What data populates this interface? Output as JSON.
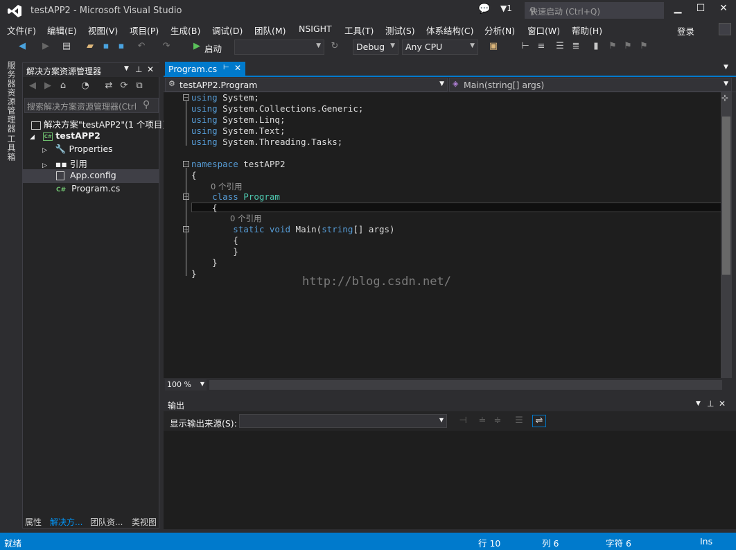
{
  "window": {
    "title": "testAPP2 - Microsoft Visual Studio",
    "notify_count": "1",
    "quick_launch_placeholder": "快速启动 (Ctrl+Q)",
    "login": "登录"
  },
  "menu": [
    "文件(F)",
    "编辑(E)",
    "视图(V)",
    "项目(P)",
    "生成(B)",
    "调试(D)",
    "团队(M)",
    "NSIGHT",
    "工具(T)",
    "测试(S)",
    "体系结构(C)",
    "分析(N)",
    "窗口(W)",
    "帮助(H)"
  ],
  "toolbar": {
    "start_label": "启动",
    "config": "Debug",
    "platform": "Any CPU"
  },
  "left_tabs": [
    "服务器资源管理器",
    "工具箱"
  ],
  "solution_explorer": {
    "title": "解决方案资源管理器",
    "search_placeholder": "搜索解决方案资源管理器(Ctrl",
    "solution": "解决方案\"testAPP2\"(1 个项目)",
    "project": "testAPP2",
    "items": [
      "Properties",
      "引用",
      "App.config",
      "Program.cs"
    ],
    "bottom_tabs": [
      "属性",
      "解决方...",
      "团队资...",
      "类视图"
    ]
  },
  "editor": {
    "tab": "Program.cs",
    "nav_class": "testAPP2.Program",
    "nav_member": "Main(string[] args)",
    "zoom": "100 %",
    "watermark": "http://blog.csdn.net/",
    "ref_hint": "0 个引用",
    "code": {
      "using_kw": "using",
      "usings": [
        "System;",
        "System.Collections.Generic;",
        "System.Linq;",
        "System.Text;",
        "System.Threading.Tasks;"
      ],
      "namespace_kw": "namespace",
      "namespace_name": "testAPP2",
      "class_kw": "class",
      "class_name": "Program",
      "static_kw": "static",
      "void_kw": "void",
      "method_name": "Main(",
      "string_kw": "string",
      "params_rest": "[] args)",
      "open_brace": "{",
      "close_brace": "}"
    }
  },
  "output": {
    "title": "输出",
    "source_label": "显示输出来源(S):"
  },
  "status": {
    "ready": "就绪",
    "line": "行 10",
    "col": "列 6",
    "char": "字符 6",
    "mode": "Ins"
  },
  "colors": {
    "accent": "#007acc",
    "keyword": "#569cd6",
    "type": "#4ec9b0",
    "editor_bg": "#1e1e1e"
  }
}
